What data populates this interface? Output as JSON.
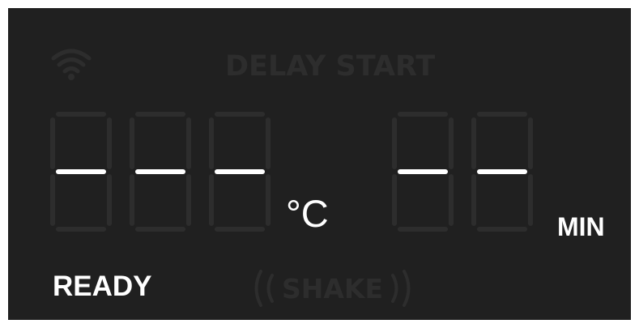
{
  "display": {
    "delay_start_label": "DELAY START",
    "temperature_unit": "°C",
    "time_unit": "MIN",
    "status_label": "READY",
    "shake_label": "SHAKE",
    "temperature_value": "---",
    "time_value": "--",
    "icons": {
      "wifi": "wifi-icon",
      "shake_left": "shake-waves-left-icon",
      "shake_right": "shake-waves-right-icon"
    }
  },
  "colors": {
    "panel_background": "#202020",
    "lit_segment": "#ffffff",
    "unlit_segment": "#2d2d2d",
    "inactive_indicator": "#2d2d2d",
    "active_text": "#ffffff"
  }
}
